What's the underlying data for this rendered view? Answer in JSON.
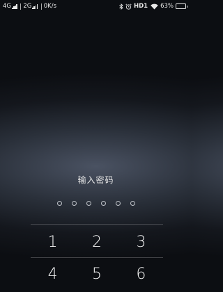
{
  "status_bar": {
    "network1": "4G",
    "network2": "2G",
    "speed": "0K/s",
    "hd": "HD1",
    "battery": "63%",
    "battery_level": 0.63,
    "icons": [
      "bluetooth-icon",
      "alarm-icon",
      "wifi-icon"
    ]
  },
  "lock": {
    "prompt": "输入密码",
    "pin_length": 6,
    "keys": [
      "1",
      "2",
      "3",
      "4",
      "5",
      "6"
    ]
  },
  "colors": {
    "text": "#ffffff",
    "dot_outline": "#bfc3c9"
  }
}
